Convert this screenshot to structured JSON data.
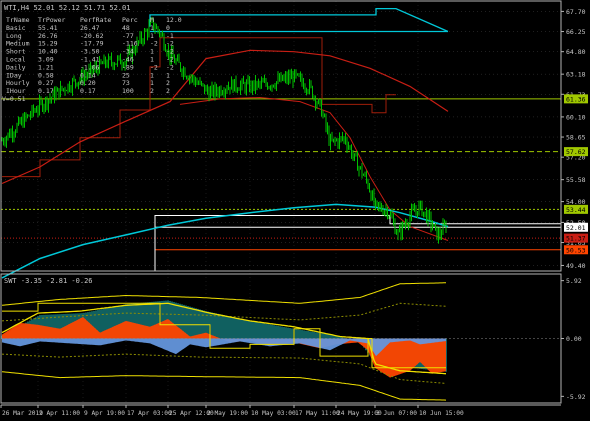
{
  "colors": {
    "background": "#000000",
    "frame": "#b4b4b4",
    "grid": "#8a8a8a",
    "candles": "#00c000",
    "resistance": "#ffffff",
    "cyan": "#00c8d8",
    "red": "#c81e14",
    "dark_red": "#a01e0a",
    "level_green": "#a0c800",
    "olive": "#8c8c00",
    "yellow": "#f0e000",
    "orange": "#ff4500",
    "steel_blue": "#6496dc",
    "teal_fill": "#147878",
    "text": "#c8c8c8",
    "label_text": "#000000"
  },
  "main": {
    "header": "WTI,H4  52.01 52.12 51.71 52.01",
    "table": {
      "columns": [
        "TrName",
        "TrPower",
        "PerfRate",
        "Perc",
        "M",
        "12.0"
      ],
      "rows": [
        [
          "Basic",
          "55.41",
          "26.47",
          "48",
          "1",
          "0"
        ],
        [
          "Long",
          "26.76",
          "-20.62",
          "-77",
          "1",
          "-1"
        ],
        [
          "Medium",
          "15.29",
          "-17.79",
          "-116",
          "-2",
          "-2"
        ],
        [
          "Short",
          "10.40",
          "-3.50",
          "-34",
          "1",
          "-2"
        ],
        [
          "Local",
          "3.09",
          "-1.41",
          "-46",
          "1",
          "-2"
        ],
        [
          "Daily",
          "1.21",
          "-1.06",
          "-89",
          "-2",
          "-2"
        ],
        [
          "IDay",
          "0.58",
          "0.14",
          "25",
          "1",
          "1"
        ],
        [
          "Hourly",
          "0.27",
          "0.20",
          "73",
          "1",
          "2"
        ],
        [
          "IHour",
          "0.17",
          "0.17",
          "100",
          "2",
          "2"
        ]
      ],
      "footer": "V=0.51"
    },
    "price_axis": {
      "ticks": [
        "67.70",
        "66.25",
        "64.80",
        "63.18",
        "61.73",
        "60.10",
        "58.65",
        "57.20",
        "55.58",
        "54.00",
        "52.50",
        "51.05",
        "49.40"
      ],
      "tick_values": [
        67.7,
        66.25,
        64.8,
        63.18,
        61.73,
        60.1,
        58.65,
        57.2,
        55.58,
        54.0,
        52.5,
        51.05,
        49.4
      ],
      "range": [
        49.0,
        68.45
      ]
    },
    "level_labels": [
      {
        "text": "61.36",
        "value": 61.4,
        "color": "#a0c800",
        "text_color": "#000000"
      },
      {
        "text": "57.62",
        "value": 57.6,
        "color": "#a0c800",
        "text_color": "#000000"
      },
      {
        "text": "53.44",
        "value": 53.44,
        "color": "#a0c800",
        "text_color": "#000000"
      },
      {
        "text": "52.01",
        "value": 52.15,
        "color": "#ffffff",
        "text_color": "#000000"
      },
      {
        "text": "51.37",
        "value": 51.37,
        "color": "#c81e14",
        "text_color": "#000000"
      },
      {
        "text": "50.53",
        "value": 50.53,
        "color": "#ff4500",
        "text_color": "#000000"
      }
    ]
  },
  "sub": {
    "header": "SWT -3.35 -2.81 -0.26",
    "axis": {
      "ticks": [
        "5.92",
        "0.00",
        "-5.92"
      ],
      "tick_values": [
        5.92,
        0.0,
        -5.92
      ],
      "range": [
        -6.6,
        6.6
      ]
    }
  },
  "time_axis": [
    "26 Mar 2019",
    "2 Apr 11:00",
    "9 Apr 19:00",
    "17 Apr 03:00",
    "25 Apr 12:00",
    "2 May 19:00",
    "10 May 03:00",
    "17 May 11:00",
    "24 May 19:00",
    "3 Jun 07:00",
    "10 Jun 15:00"
  ],
  "chart_data": [
    {
      "type": "line",
      "title": "WTI,H4",
      "subtitle": "52.01 52.12 51.71 52.01",
      "xlabel": "",
      "ylabel": "",
      "ylim": [
        49.0,
        68.45
      ],
      "x": [
        "26 Mar 2019",
        "2 Apr 11:00",
        "9 Apr 19:00",
        "17 Apr 03:00",
        "25 Apr 12:00",
        "2 May 19:00",
        "10 May 03:00",
        "17 May 11:00",
        "24 May 19:00",
        "3 Jun 07:00",
        "10 Jun 15:00"
      ],
      "series": [
        {
          "name": "",
          "color": "#00c000",
          "style": "candles",
          "values": [
            58.6,
            61.6,
            63.8,
            64.1,
            65.3,
            62.0,
            62.0,
            62.6,
            58.6,
            53.0,
            53.8
          ]
        },
        {
          "name": "",
          "color": "#c81e14",
          "style": "line",
          "values": [
            56.0,
            57.7,
            59.7,
            61.0,
            62.6,
            64.4,
            64.6,
            64.2,
            62.2,
            55.3,
            51.4
          ]
        },
        {
          "name": "",
          "color": "#00c8d8",
          "style": "line",
          "values": [
            49.0,
            50.2,
            51.3,
            52.1,
            52.7,
            53.1,
            53.4,
            53.6,
            53.8,
            53.4,
            52.2
          ]
        }
      ],
      "levels": [
        61.4,
        57.6,
        53.44,
        51.37,
        50.53
      ]
    },
    {
      "type": "area",
      "title": "SWT",
      "subtitle": "-3.35 -2.81 -0.26",
      "ylim": [
        -6.6,
        6.6
      ],
      "x": [
        "26 Mar 2019",
        "2 Apr 11:00",
        "9 Apr 19:00",
        "17 Apr 03:00",
        "25 Apr 12:00",
        "2 May 19:00",
        "10 May 03:00",
        "17 May 11:00",
        "24 May 19:00",
        "3 Jun 07:00",
        "10 Jun 15:00"
      ],
      "series": [
        {
          "name": "",
          "color": "#147878",
          "values": [
            0.6,
            2.4,
            2.6,
            3.5,
            3.9,
            2.8,
            1.8,
            0.8,
            0.2,
            -2.5,
            -3.4
          ]
        },
        {
          "name": "",
          "color": "#ff4500",
          "values": [
            1.0,
            1.6,
            1.7,
            1.7,
            1.5,
            0.6,
            -0.4,
            -1.0,
            -1.4,
            -2.8,
            -3.35
          ]
        },
        {
          "name": "",
          "color": "#6496dc",
          "values": [
            -1.3,
            -0.4,
            -0.6,
            -0.5,
            -1.0,
            -2.0,
            -1.8,
            -1.6,
            -1.0,
            -0.6,
            -0.26
          ]
        }
      ]
    }
  ]
}
